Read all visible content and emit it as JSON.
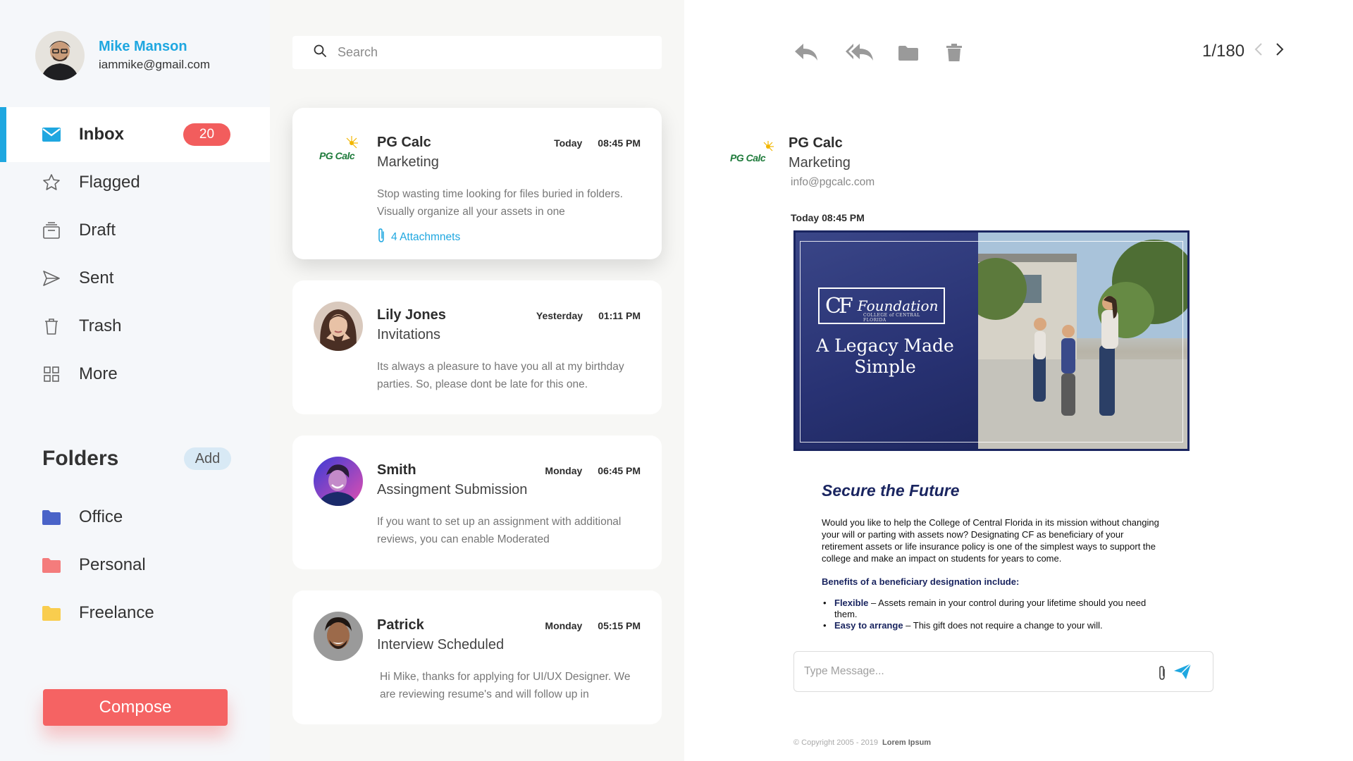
{
  "colors": {
    "accent": "#1fa7e0",
    "danger": "#f56363",
    "badge": "#f25d5d",
    "folder_office": "#4a63c8",
    "folder_personal": "#f47c7c",
    "folder_freelance": "#f9cd4e"
  },
  "user": {
    "name": "Mike Manson",
    "email": "iammike@gmail.com"
  },
  "nav": {
    "items": [
      {
        "label": "Inbox",
        "icon": "mail-icon",
        "badge": "20",
        "active": true
      },
      {
        "label": "Flagged",
        "icon": "star-icon"
      },
      {
        "label": "Draft",
        "icon": "draft-icon"
      },
      {
        "label": "Sent",
        "icon": "send-icon"
      },
      {
        "label": "Trash",
        "icon": "trash-icon"
      },
      {
        "label": "More",
        "icon": "grid-icon"
      }
    ]
  },
  "folders": {
    "title": "Folders",
    "add_label": "Add",
    "items": [
      {
        "label": "Office",
        "icon": "folder-icon"
      },
      {
        "label": "Personal",
        "icon": "folder-icon"
      },
      {
        "label": "Freelance",
        "icon": "folder-icon"
      }
    ]
  },
  "compose_label": "Compose",
  "search": {
    "placeholder": "Search"
  },
  "mails": [
    {
      "sender": "PG Calc",
      "day": "Today",
      "time": "08:45 PM",
      "subject": "Marketing",
      "preview": "Stop wasting time looking for files buried in folders. Visually organize all your assets in one",
      "attachments": "4 Attachmnets",
      "logo_text": "PG Calc"
    },
    {
      "sender": "Lily Jones",
      "day": "Yesterday",
      "time": "01:11 PM",
      "subject": "Invitations",
      "preview": "Its always a pleasure to have you all at my birthday parties. So, please dont be late for this one."
    },
    {
      "sender": "Smith",
      "day": "Monday",
      "time": "06:45 PM",
      "subject": "Assingment Submission",
      "preview": "If you want to set up an assignment with additional reviews, you can enable Moderated"
    },
    {
      "sender": "Patrick",
      "day": "Monday",
      "time": "05:15 PM",
      "subject": "Interview Scheduled",
      "preview": "Hi Mike, thanks for applying for UI/UX Designer. We are reviewing resume's and will follow up in"
    }
  ],
  "toolbar": {
    "icons": [
      "reply-icon",
      "reply-all-icon",
      "folder-icon",
      "trash-icon"
    ],
    "pager": "1/180"
  },
  "reader": {
    "sender": "PG Calc",
    "subject": "Marketing",
    "email": "info@pgcalc.com",
    "date": "Today 08:45 PM",
    "logo_text": "PG Calc",
    "banner": {
      "cf_mark": "CF",
      "cf_word": "Foundation",
      "cf_sub": "COLLEGE of CENTRAL FLORIDA",
      "tagline": "A Legacy Made Simple"
    },
    "heading": "Secure the Future",
    "paragraph": "Would you like to help the College of Central Florida in its mission without changing your will or parting with assets now? Designating CF as beneficiary of your retirement assets or life insurance policy is one of the simplest ways to support the college and make an impact on students for years to come.",
    "benefits_title": "Benefits of a beneficiary designation include:",
    "benefits": [
      {
        "term": "Flexible",
        "text": " – Assets remain in your control during your lifetime should you need them."
      },
      {
        "term": "Easy to arrange",
        "text": " – This gift does not require a change to your will."
      }
    ],
    "reply_placeholder": "Type Message...",
    "footer_copy": "© Copyright 2005 - 2019",
    "footer_brand": "Lorem Ipsum"
  }
}
